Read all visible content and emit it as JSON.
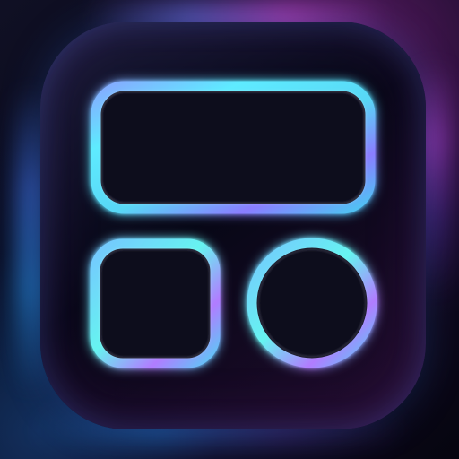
{
  "app_icon": {
    "icon": "widget-layout-icon",
    "colors": {
      "background_dark": "#050512",
      "glow_blue": "#38C8F2",
      "glow_cyan": "#5AF3EA",
      "glow_purple": "#9B7DFF",
      "glow_magenta": "#C153D6"
    },
    "shapes": [
      {
        "name": "wide-rounded-rectangle",
        "icon": "rounded-rectangle-outline-icon"
      },
      {
        "name": "small-rounded-square",
        "icon": "rounded-square-outline-icon"
      },
      {
        "name": "circle",
        "icon": "circle-outline-icon"
      }
    ]
  }
}
